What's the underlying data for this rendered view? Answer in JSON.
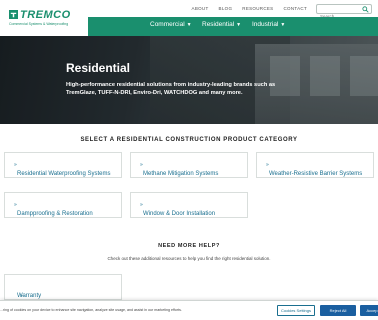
{
  "header": {
    "logo_text": "TREMCO",
    "logo_tagline": "Commercial Systems & Waterproofing",
    "utility_links": [
      "ABOUT",
      "BLOG",
      "RESOURCES",
      "CONTACT"
    ],
    "search_placeholder": "Search"
  },
  "main_nav": [
    {
      "label": "Commercial"
    },
    {
      "label": "Residential"
    },
    {
      "label": "Industrial"
    }
  ],
  "hero": {
    "title": "Residential",
    "subtitle": "High-performance residential solutions from industry-leading brands such as TremGlaze, TUFF-N-DRI, Enviro-Dri, WATCHDOG and many more."
  },
  "categories": {
    "heading": "SELECT A RESIDENTIAL CONSTRUCTION PRODUCT CATEGORY",
    "items": [
      {
        "label": "Residential Waterproofing Systems"
      },
      {
        "label": "Methane Mitigation Systems"
      },
      {
        "label": "Weather-Resistive Barrier Systems"
      },
      {
        "label": "Dampproofing & Restoration"
      },
      {
        "label": "Window & Door Installation"
      }
    ]
  },
  "help": {
    "heading": "NEED MORE HELP?",
    "text": "Check out these additional resources to help you find the right residential solution.",
    "warranty_label": "Warranty"
  },
  "cookie": {
    "message": "...ring of cookies on your device to enhance site navigation, analyze site usage, and assist in our marketing efforts.",
    "settings_label": "Cookies Settings",
    "reject_label": "Reject All",
    "accept_label": "Accep"
  },
  "colors": {
    "brand_green": "#1a8f6e",
    "link_blue": "#1a6f8f",
    "button_blue": "#1a5fa0"
  }
}
